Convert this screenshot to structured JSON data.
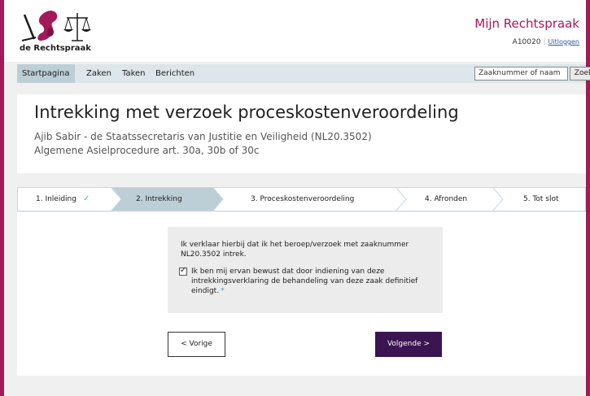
{
  "header": {
    "logo_text": "de Rechtspraak",
    "brand": "Mijn Rechtspraak",
    "user_id": "A10020",
    "logout": "Uitloggen"
  },
  "nav": {
    "items": [
      "Startpagina",
      "Zaken",
      "Taken",
      "Berichten"
    ],
    "search_placeholder": "Zaaknummer of naam",
    "search_button": "Zoek"
  },
  "page": {
    "title": "Intrekking met verzoek proceskostenveroordeling",
    "subtitle_line1": "Ajib Sabir - de Staatssecretaris van Justitie en Veiligheid (NL20.3502)",
    "subtitle_line2": "Algemene Asielprocedure art. 30a, 30b of 30c"
  },
  "steps": [
    {
      "label": "1. Inleiding",
      "state": "done"
    },
    {
      "label": "2. Intrekking",
      "state": "active"
    },
    {
      "label": "3. Proceskostenveroordeling",
      "state": "todo"
    },
    {
      "label": "4. Afronden",
      "state": "todo"
    },
    {
      "label": "5. Tot slot",
      "state": "todo"
    }
  ],
  "form": {
    "declaration": "Ik verklaar hierbij dat ik het beroep/verzoek met zaaknummer NL20.3502 intrek.",
    "checkbox_label": "Ik ben mij ervan bewust dat door indiening van deze intrekkingsverklaring de behandeling van deze zaak definitief eindigt.",
    "checkbox_checked": true,
    "required_marker": "*",
    "prev_button": "< Vorige",
    "next_button": "Volgende >"
  },
  "colors": {
    "brand": "#a3195b",
    "step_active": "#bccfd7",
    "next_button": "#3b1452",
    "required": "#4a9dd4"
  }
}
